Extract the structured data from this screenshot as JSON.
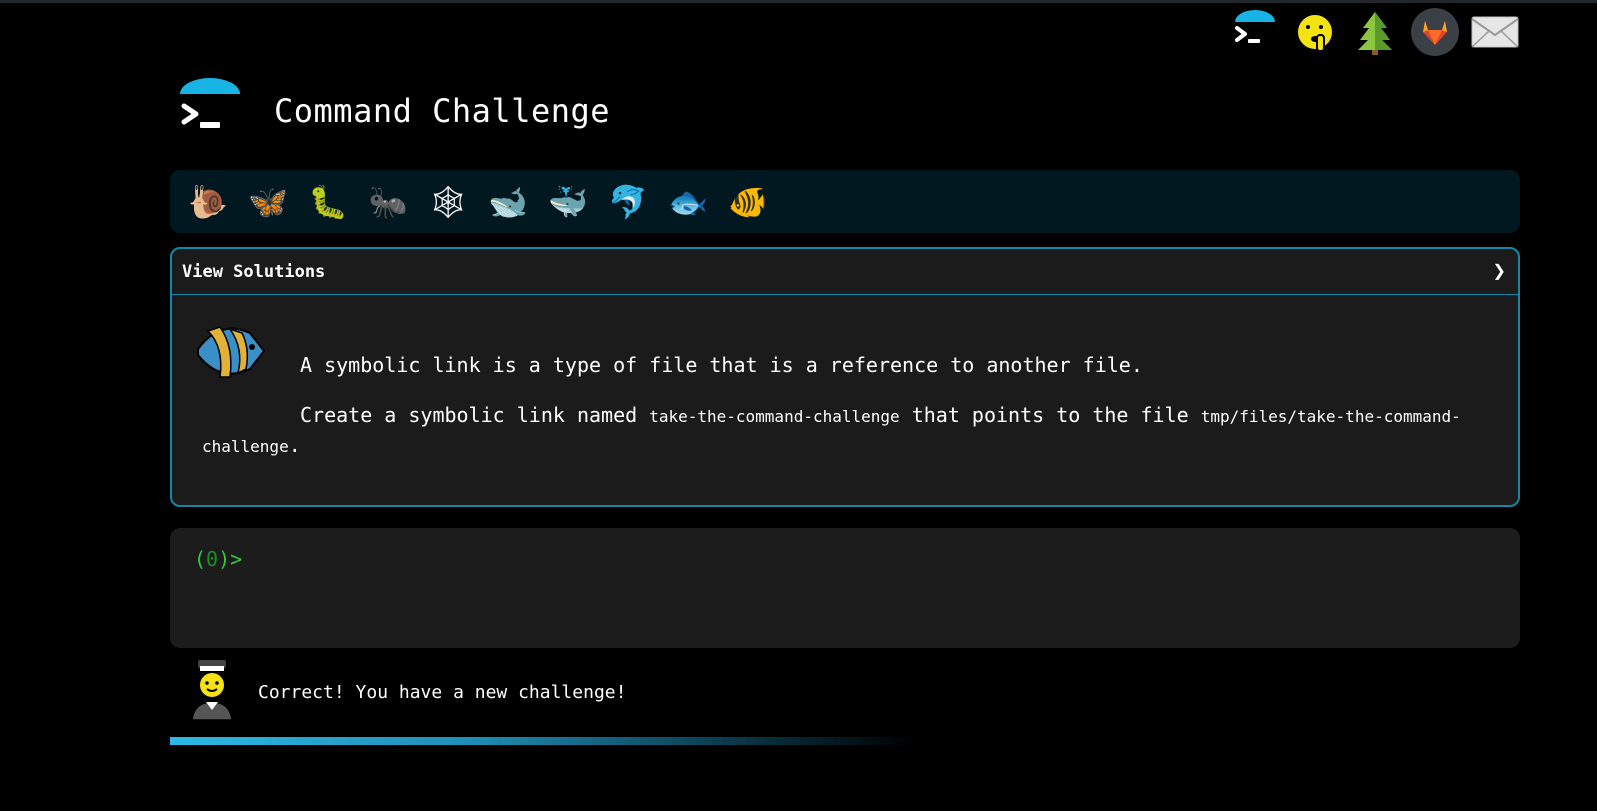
{
  "header": {
    "title": "Command Challenge"
  },
  "top_nav": {
    "items": [
      {
        "name": "terminal-logo-icon"
      },
      {
        "name": "shushing-face-icon"
      },
      {
        "name": "christmas-tree-icon"
      },
      {
        "name": "gitlab-icon"
      },
      {
        "name": "envelope-icon"
      }
    ]
  },
  "levels": [
    {
      "icon": "snail-icon",
      "glyph": "🐌"
    },
    {
      "icon": "butterfly-icon",
      "glyph": "🦋"
    },
    {
      "icon": "caterpillar-icon",
      "glyph": "🐛"
    },
    {
      "icon": "ant-icon",
      "glyph": "🐜"
    },
    {
      "icon": "spider-web-icon",
      "glyph": "🕸"
    },
    {
      "icon": "whale-icon",
      "glyph": "🐋"
    },
    {
      "icon": "spouting-whale-icon",
      "glyph": "🐳"
    },
    {
      "icon": "dolphin-icon",
      "glyph": "🐬"
    },
    {
      "icon": "fish-icon",
      "glyph": "🐟"
    },
    {
      "icon": "tropical-fish-icon",
      "glyph": "🐠"
    }
  ],
  "solutions": {
    "label": "View Solutions",
    "chevron": "❯"
  },
  "challenge": {
    "line1": "A symbolic link is a type of file that is a reference to another file.",
    "line2_a": "Create a symbolic link named ",
    "code1": "take-the-command-challenge",
    "line2_b": " that points to the file ",
    "code2": "tmp/files/take-the-command-challenge",
    "line2_c": "."
  },
  "terminal": {
    "prompt_open": "(",
    "prompt_count": "0",
    "prompt_close": ")>",
    "input_value": ""
  },
  "feedback": {
    "text": "Correct! You have a new challenge!"
  },
  "progress": {
    "fraction": 0.55
  },
  "colors": {
    "accent": "#1686a8",
    "prompt": "#2ecc40",
    "panel_bg": "#1b1b1b",
    "bar_bg": "#021820"
  }
}
